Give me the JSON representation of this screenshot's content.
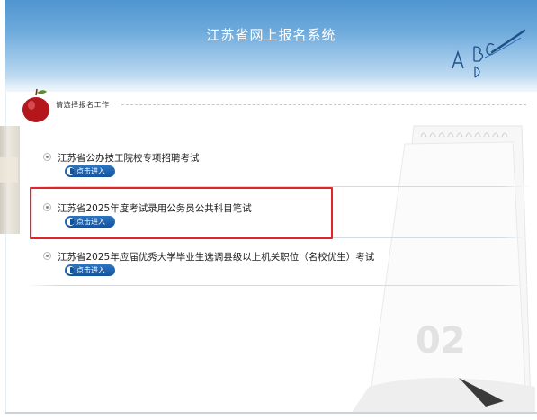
{
  "header": {
    "title": "江苏省网上报名系统",
    "doodle_text": "ABC D"
  },
  "section": {
    "title": "请选择报名工作"
  },
  "exams": [
    {
      "title": "江苏省公办技工院校专项招聘考试",
      "button": "点击进入"
    },
    {
      "title": "江苏省2025年度考试录用公务员公共科目笔试",
      "button": "点击进入"
    },
    {
      "title": "江苏省2025年应届优秀大学毕业生选调县级以上机关职位（名校优生）考试",
      "button": "点击进入"
    }
  ],
  "decor": {
    "calendar_number": "02"
  },
  "colors": {
    "header_blue": "#4f95cf",
    "button_blue": "#13539c",
    "highlight_red": "#e0262c"
  }
}
